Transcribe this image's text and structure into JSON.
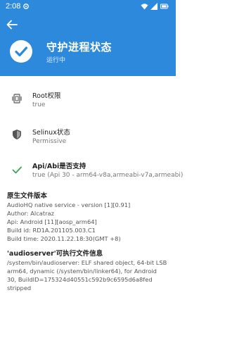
{
  "status_bar": {
    "time": "2:08"
  },
  "header": {
    "title": "守护进程状态",
    "subtitle": "运行中",
    "bg_color": "#2d89dc"
  },
  "rows": [
    {
      "title": "Root权限",
      "value": "true",
      "icon": "root-permission-icon"
    },
    {
      "title": "Selinux状态",
      "value": "Permissive",
      "icon": "shield-icon"
    },
    {
      "title": "Api/Abi是否支持",
      "value": "true (Api 30 - arm64-v8a,armeabi-v7a,armeabi)",
      "icon": "check-icon"
    }
  ],
  "native_service": {
    "title": "原生文件版本",
    "lines": [
      "AudioHQ native service - version [1][0.91]",
      "Author: Alcatraz",
      "Api: Android [11][aosp_arm64]",
      "Build id: RD1A.201105.003.C1",
      "Build time: 2020.11.22.18:30(GMT +8)"
    ]
  },
  "audioserver": {
    "title": "'audioserver'可执行文件信息",
    "lines": [
      "/system/bin/audioserver: ELF shared object, 64-bit LSB",
      "arm64, dynamic (/system/bin/linker64), for Android",
      "30, BuildID=175324d40551c592b9c6595d6a8fed",
      "stripped"
    ]
  }
}
